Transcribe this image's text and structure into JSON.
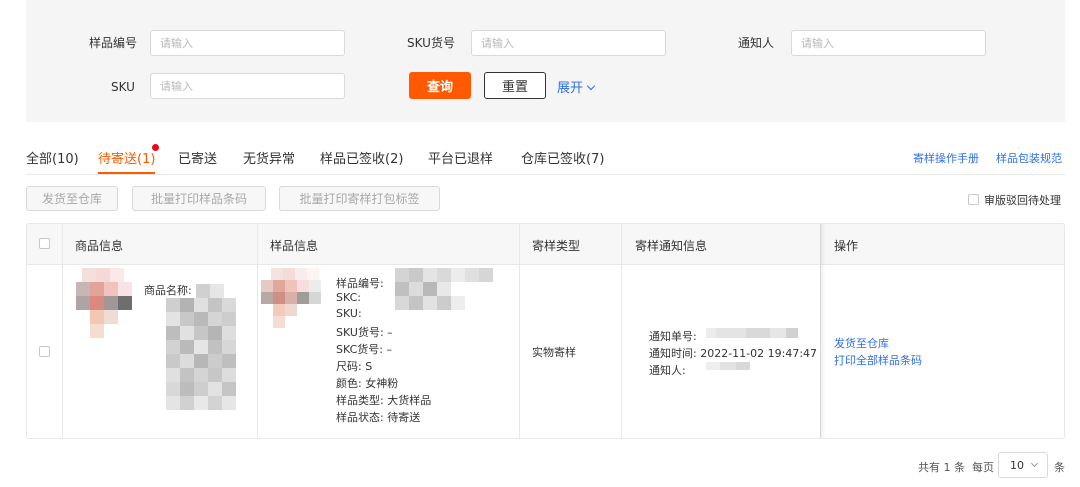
{
  "filters": {
    "sample_no": {
      "label": "样品编号",
      "placeholder": "请输入"
    },
    "sku_no": {
      "label": "SKU货号",
      "placeholder": "请输入"
    },
    "notifier": {
      "label": "通知人",
      "placeholder": "请输入"
    },
    "sku": {
      "label": "SKU",
      "placeholder": "请输入"
    },
    "query_label": "查询",
    "reset_label": "重置",
    "expand_label": "展开"
  },
  "tabs": [
    {
      "label": "全部(10)"
    },
    {
      "label": "待寄送(1)"
    },
    {
      "label": "已寄送"
    },
    {
      "label": "无货异常"
    },
    {
      "label": "样品已签收(2)"
    },
    {
      "label": "平台已退样"
    },
    {
      "label": "仓库已签收(7)"
    }
  ],
  "links": {
    "manual": "寄样操作手册",
    "packaging": "样品包装规范"
  },
  "actions": {
    "ship_to_warehouse": "发货至仓库",
    "batch_print_barcode": "批量打印样品条码",
    "batch_print_label": "批量打印寄样打包标签",
    "pending_review": "审版驳回待处理"
  },
  "table": {
    "headers": [
      "商品信息",
      "样品信息",
      "寄样类型",
      "寄样通知信息",
      "操作"
    ],
    "row": {
      "product_name_label": "商品名称:",
      "sample": {
        "sample_no": "样品编号:",
        "skc": "SKC:",
        "sku": "SKU:",
        "sku_no": "SKU货号: –",
        "skc_no": "SKC货号: –",
        "size": "尺码: S",
        "color": "颜色: 女神粉",
        "sample_type": "样品类型: 大货样品",
        "sample_status": "样品状态: 待寄送"
      },
      "ship_type": "实物寄样",
      "notice": {
        "notice_no": "通知单号:",
        "notice_time": "通知时间: 2022-11-02 19:47:47",
        "notifier": "通知人:"
      },
      "ops": [
        "发货至仓库",
        "打印全部样品条码"
      ]
    }
  },
  "pagination": {
    "total": "共有 1 条",
    "per_page_label": "每页",
    "per_page_value": "10",
    "unit": "条"
  }
}
